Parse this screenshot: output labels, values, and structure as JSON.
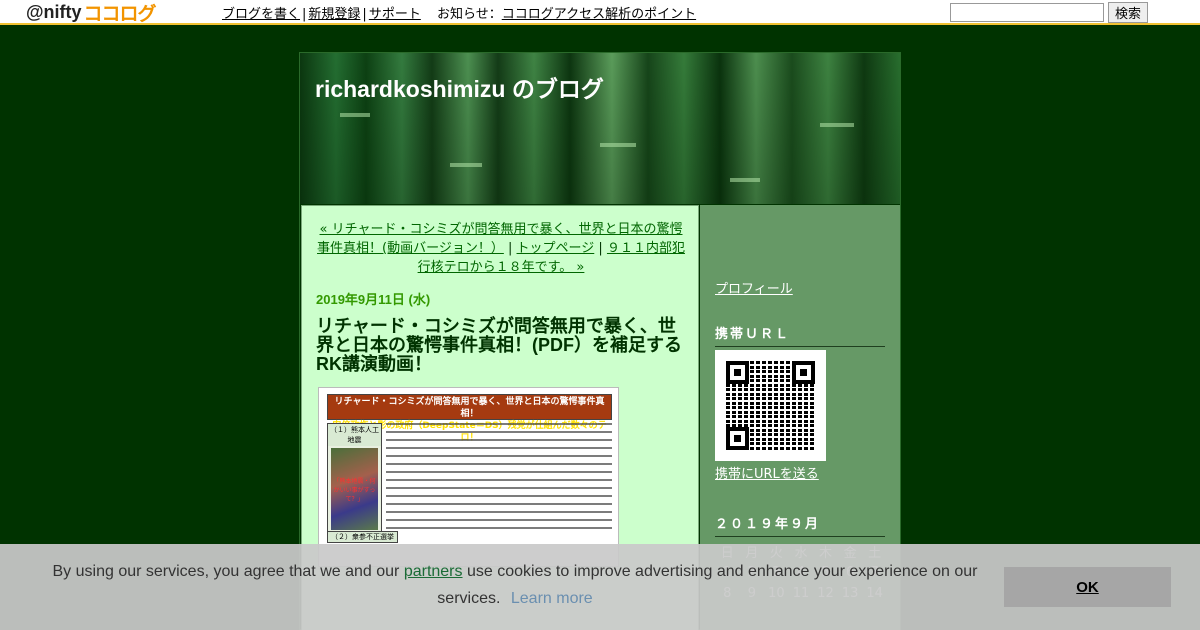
{
  "topbar": {
    "logo_at": "@nifty",
    "logo_cocolog": "ココログ",
    "nav": [
      "ブログを書く",
      "新規登録",
      "サポート"
    ],
    "news_label": "お知らせ",
    "news_colon": "：",
    "news_link": "ココログアクセス解析のポイント",
    "search_value": "",
    "search_button": "検索"
  },
  "blog": {
    "title": "richardkoshimizu のブログ"
  },
  "post": {
    "prev_link": "« リチャード・コシミズが問答無用で暴く、世界と日本の驚愕事件真相！(動画バージョン！）",
    "nav_sep": "|",
    "top_link": "トップページ",
    "next_link": "９１１内部犯行核テロから１８年です。 »",
    "date": "2019年9月11日 (水)",
    "title": "リチャード・コシミズが問答無用で暴く、世界と日本の驚愕事件真相！(PDF）を補足するRK講演動画！",
    "flyer_heading_1": "リチャード・コシミズが問答無用で暴く、世界と日本の驚愕事件真相！",
    "flyer_heading_2": "安倍政権と影の政府（DeepState＝DS）残党が仕組んだ数々のテロ！",
    "flyer_tag_1": "（１）熊本人工地震",
    "flyer_tag_2": "（２）衆参不正選挙",
    "flyer_image_caption": "「熊本地震・何かいい事がすって？」"
  },
  "sidebar": {
    "profile_link": "プロフィール",
    "mobile_heading": "携帯ＵＲＬ",
    "mobile_link": "携帯にURLを送る",
    "calendar_heading": "２０１９年９月",
    "weekdays": [
      "日",
      "月",
      "火",
      "水",
      "木",
      "金",
      "土"
    ],
    "week1": [
      "1",
      "2",
      "3",
      "4",
      "5",
      "6",
      "7"
    ],
    "week2": [
      "8",
      "9",
      "10",
      "11",
      "12",
      "13",
      "14"
    ]
  },
  "cookie": {
    "text_before": "By using our services, you agree that we and our ",
    "partners_link": "partners",
    "text_after": " use cookies to improve advertising and enhance your experience on our services.",
    "learn_more": "Learn more",
    "ok_button": "OK"
  }
}
